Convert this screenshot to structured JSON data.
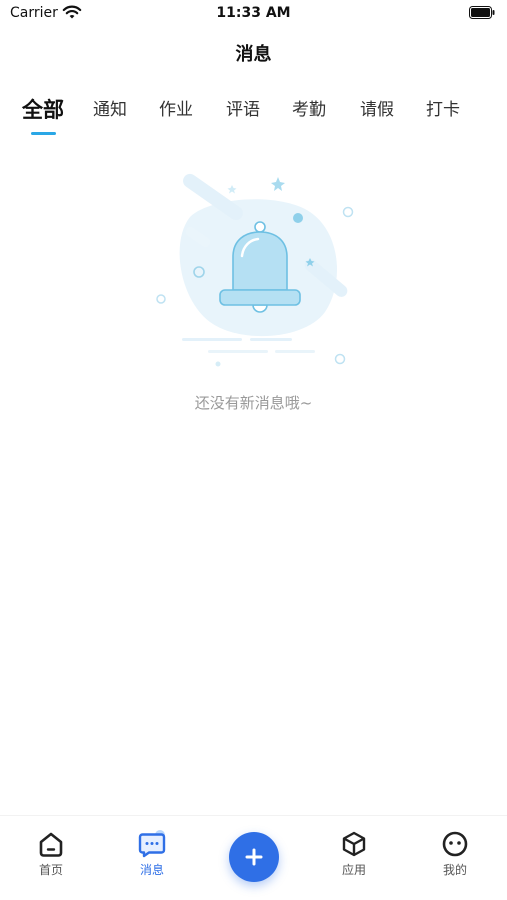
{
  "status_bar": {
    "carrier": "Carrier",
    "time": "11:33 AM"
  },
  "header": {
    "title": "消息"
  },
  "tabs": [
    {
      "label": "全部",
      "active": true
    },
    {
      "label": "通知"
    },
    {
      "label": "作业"
    },
    {
      "label": "评语"
    },
    {
      "label": "考勤"
    },
    {
      "label": "请假"
    },
    {
      "label": "打卡"
    }
  ],
  "empty_state": {
    "message": "还没有新消息哦~",
    "icon": "bell-icon"
  },
  "bottom_nav": {
    "items": [
      {
        "label": "首页",
        "icon": "home-icon"
      },
      {
        "label": "消息",
        "icon": "message-icon",
        "active": true
      },
      {
        "label": "应用",
        "icon": "cube-icon"
      },
      {
        "label": "我的",
        "icon": "profile-icon"
      }
    ],
    "fab_icon": "plus-icon"
  },
  "colors": {
    "accent": "#2aa7e6",
    "nav_active": "#2f6fe6",
    "fab": "#2f6fe6"
  }
}
